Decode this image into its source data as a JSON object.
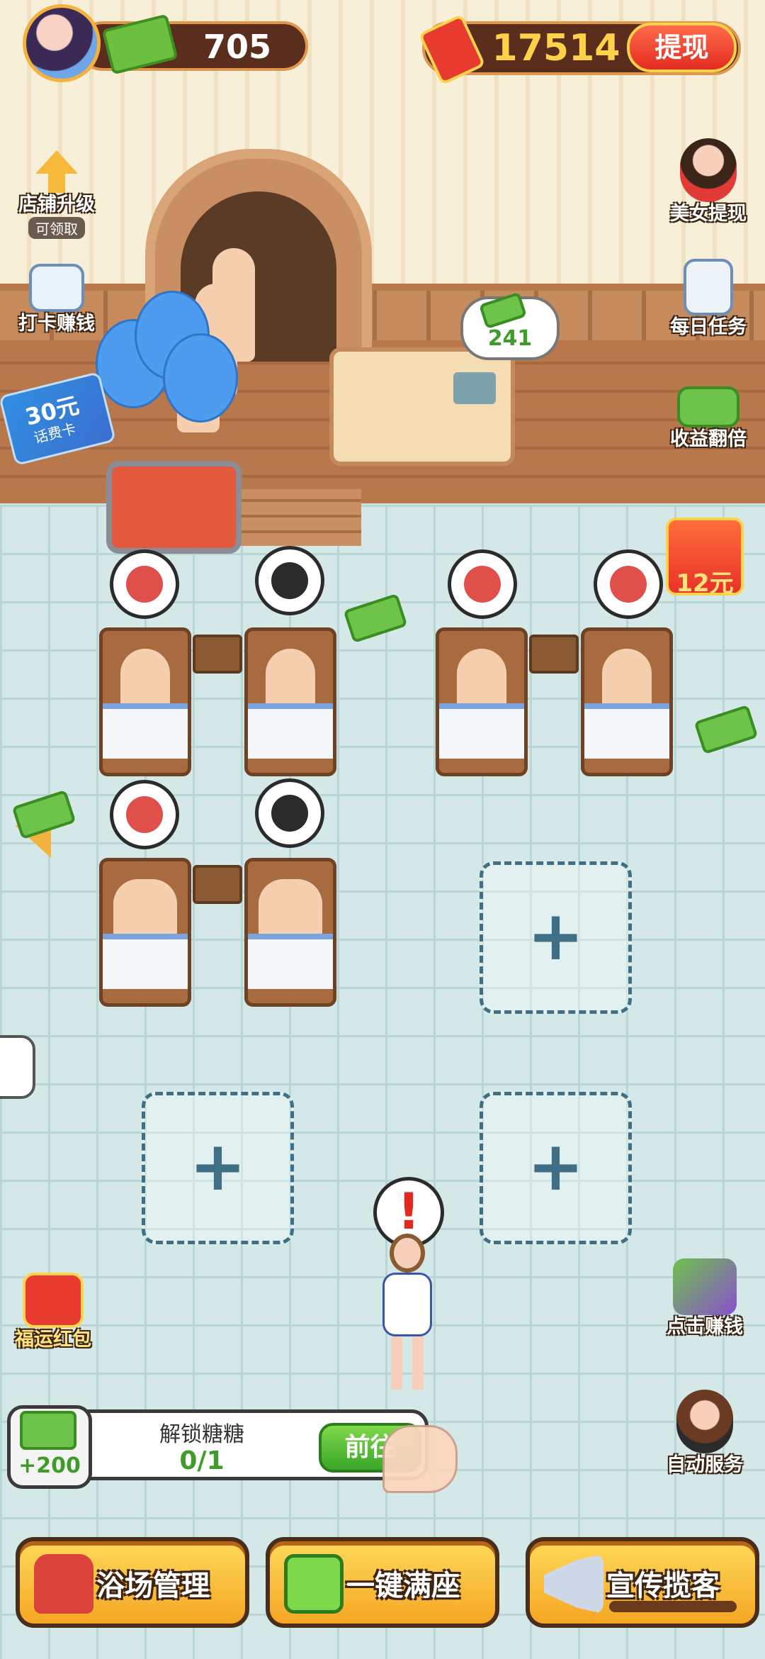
{
  "hud": {
    "cash": "705",
    "red_packet": "17514",
    "withdraw_label": "提现"
  },
  "left_menu": {
    "shop_upgrade": "店铺升级",
    "shop_upgrade_badge": "可领取",
    "checkin_earn": "打卡赚钱",
    "phone_card_value": "30元",
    "phone_card_label": "话费卡",
    "lucky_red_packet": "福运红包"
  },
  "right_menu": {
    "beauty_withdraw": "美女提现",
    "daily_tasks": "每日任务",
    "double_income": "收益翻倍",
    "coupon_value": "12元",
    "click_earn": "点击赚钱",
    "auto_service": "自动服务"
  },
  "scene": {
    "reception_bubble": "241",
    "empty_slot_symbol": "+",
    "alert_symbol": "!"
  },
  "quest": {
    "reward": "+200",
    "title": "解锁糖糖",
    "progress": "0/1",
    "go_label": "前往"
  },
  "bottom_bar": {
    "manage": "浴场管理",
    "fill_seats": "一键满座",
    "promote": "宣传揽客"
  },
  "colors": {
    "accent_gold": "#f5a623",
    "brand_red": "#e22c21",
    "cash_green": "#3f9b2a",
    "tile": "#d4e8e8"
  },
  "icons": {
    "balloons": "balloon-icon",
    "upgrade": "arrow-up-icon",
    "calendar": "calendar-icon",
    "task": "clipboard-icon"
  }
}
